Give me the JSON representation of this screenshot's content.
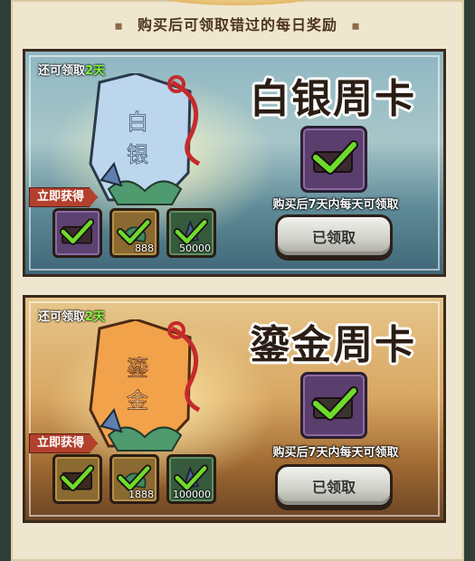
{
  "header": {
    "title": "购买后可领取错过的每日奖励"
  },
  "cards": [
    {
      "id": "silver",
      "remain_prefix": "还可领取",
      "remain_days": "2天",
      "tag_text_top": "白",
      "tag_text_bottom": "银",
      "title": "白银周卡",
      "description": "购买后7天内每天可领取",
      "button": "已领取",
      "get_now": "立即获得",
      "rewards": [
        {
          "type": "chest",
          "count": ""
        },
        {
          "type": "dragon",
          "count": "888"
        },
        {
          "type": "crystal",
          "count": "50000"
        }
      ]
    },
    {
      "id": "gold",
      "remain_prefix": "还可领取",
      "remain_days": "2天",
      "tag_text_top": "鎏",
      "tag_text_bottom": "金",
      "title": "鎏金周卡",
      "description": "购买后7天内每天可领取",
      "button": "已领取",
      "get_now": "立即获得",
      "rewards": [
        {
          "type": "chest",
          "count": ""
        },
        {
          "type": "dragon",
          "count": "1888"
        },
        {
          "type": "crystal",
          "count": "100000"
        }
      ]
    }
  ],
  "colors": {
    "check": "#6edc2a",
    "accent_red": "#b3402d",
    "days_green": "#7fff3a"
  }
}
